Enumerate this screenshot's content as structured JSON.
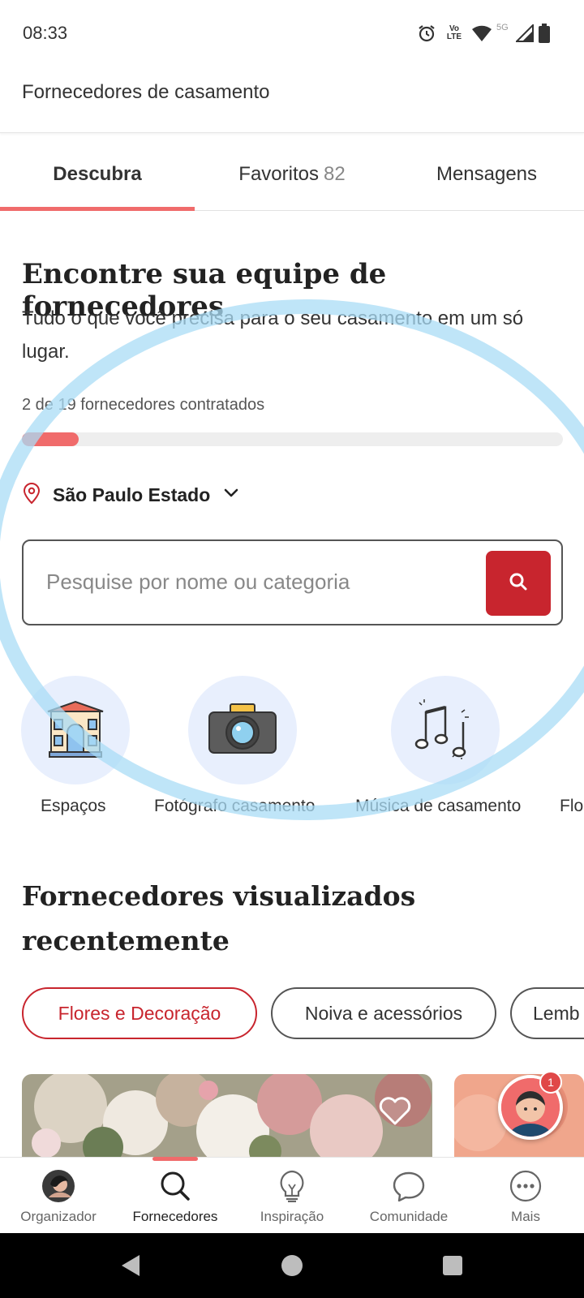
{
  "status_bar": {
    "time": "08:33",
    "volte_text": "Vo LTE",
    "network_text": "5G"
  },
  "app": {
    "title": "Fornecedores de casamento"
  },
  "tabs": [
    {
      "label": "Descubra"
    },
    {
      "label": "Favoritos",
      "count": "82"
    },
    {
      "label": "Mensagens"
    }
  ],
  "hero": {
    "title": "Encontre sua equipe de fornecedores",
    "subtitle": "Tudo o que você precisa para o seu casamento em um só lugar.",
    "progress_text": "2 de 19 fornecedores contratados",
    "progress": {
      "hired": 2,
      "total": 19
    }
  },
  "location": {
    "label": "São Paulo Estado",
    "icon": "location-pin-icon"
  },
  "search": {
    "placeholder": "Pesquise por nome ou categoria"
  },
  "categories": [
    {
      "label": "Espaços",
      "icon": "venue-building-icon"
    },
    {
      "label": "Fotógrafo casamento",
      "icon": "camera-icon"
    },
    {
      "label": "Música de casamento",
      "icon": "music-notes-icon"
    },
    {
      "label": "Flo"
    }
  ],
  "recent": {
    "title": "Fornecedores visualizados recentemente",
    "chips": [
      "Flores e Decoração",
      "Noiva e acessórios",
      "Lemb"
    ]
  },
  "floating_badge": {
    "count": "1"
  },
  "bottom_nav": [
    {
      "label": "Organizador",
      "icon": "avatar-icon"
    },
    {
      "label": "Fornecedores",
      "icon": "search-icon"
    },
    {
      "label": "Inspiração",
      "icon": "lightbulb-icon"
    },
    {
      "label": "Comunidade",
      "icon": "chat-bubble-icon"
    },
    {
      "label": "Mais",
      "icon": "more-icon"
    }
  ],
  "colors": {
    "accent": "#f06b6b",
    "brand_red": "#c8252e",
    "category_bg": "#e8effd",
    "ring": "#a9dcf5"
  }
}
